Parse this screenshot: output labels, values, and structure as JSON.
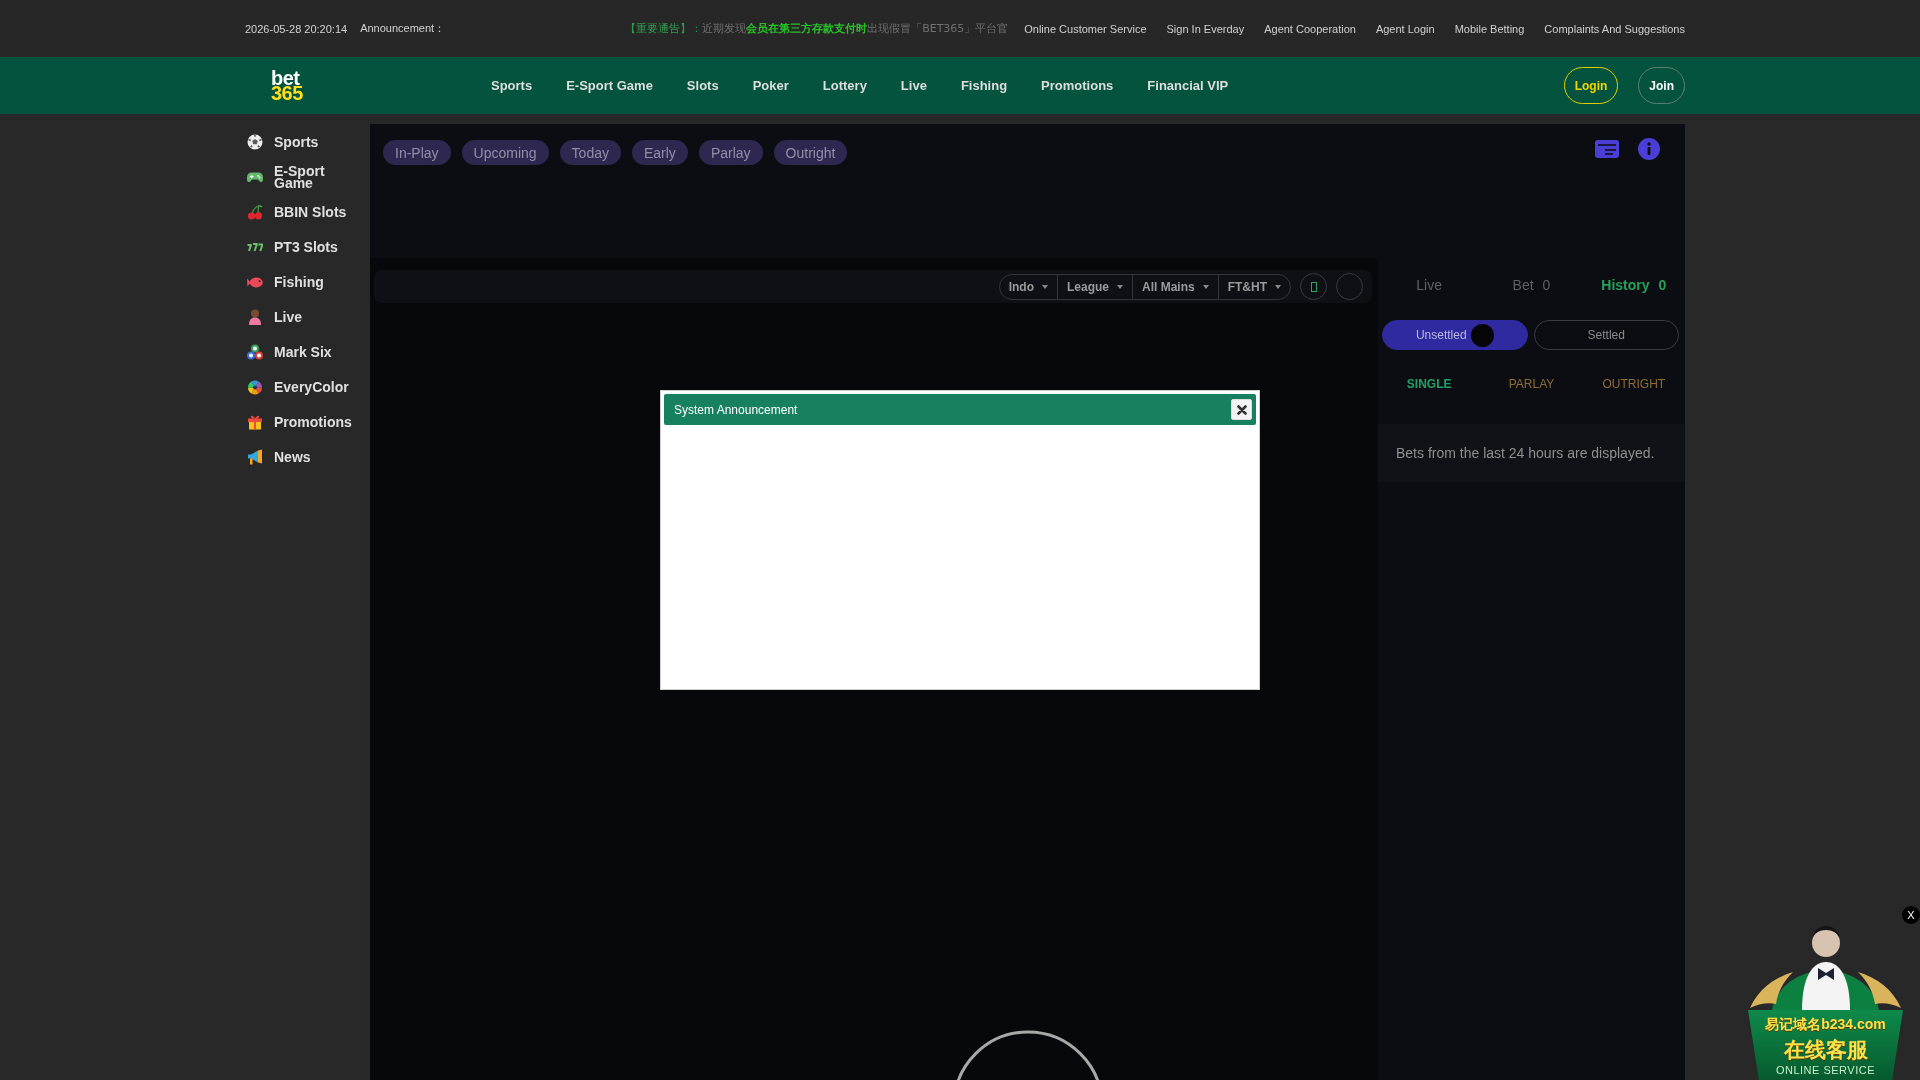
{
  "top_bar": {
    "datetime": "2026-05-28 20:20:14",
    "announcement_label": "Announcement：",
    "announcement": [
      {
        "text": "【重要通告】：",
        "kind": "tag"
      },
      {
        "text": "近期发现",
        "kind": "plain"
      },
      {
        "text": "会员在第三方存款支付时",
        "kind": "highlight"
      },
      {
        "text": "出现假冒「BET365」平台官",
        "kind": "plain"
      }
    ],
    "links": [
      "Online Customer Service",
      "Sign In Everday",
      "Agent Cooperation",
      "Agent Login",
      "Mobile Betting",
      "Complaints And Suggestions"
    ]
  },
  "nav": {
    "logo": {
      "line_1": "bet",
      "line_2": "365"
    },
    "items": [
      "Sports",
      "E-Sport Game",
      "Slots",
      "Poker",
      "Lottery",
      "Live",
      "Fishing",
      "Promotions",
      "Financial VIP"
    ],
    "login": "Login",
    "join": "Join"
  },
  "sidebar": {
    "items": [
      {
        "label": "Sports",
        "kind": "soccer"
      },
      {
        "label": "E-Sport Game",
        "kind": "gamepad"
      },
      {
        "label": "BBIN Slots",
        "kind": "cherry"
      },
      {
        "label": "PT3 Slots",
        "kind": "sevens"
      },
      {
        "label": "Fishing",
        "kind": "fish"
      },
      {
        "label": "Live",
        "kind": "person"
      },
      {
        "label": "Mark Six",
        "kind": "balls"
      },
      {
        "label": "EveryColor",
        "kind": "wheel"
      },
      {
        "label": "Promotions",
        "kind": "gift"
      },
      {
        "label": "News",
        "kind": "megaphone"
      }
    ]
  },
  "market_tabs": [
    {
      "label": "In-Play",
      "selected": false
    },
    {
      "label": "Upcoming",
      "selected": false
    },
    {
      "label": "Today",
      "selected": false
    },
    {
      "label": "Early",
      "selected": false
    },
    {
      "label": "Parlay",
      "selected": false
    },
    {
      "label": "Outright",
      "selected": false
    }
  ],
  "filters": [
    "Indo",
    "League",
    "All Mains",
    "FT&HT"
  ],
  "bet_panel": {
    "tabs": [
      {
        "label": "Live",
        "selected": false
      },
      {
        "label": "Bet",
        "count": "0",
        "selected": false
      },
      {
        "label": "History",
        "count": "0",
        "selected": true
      }
    ],
    "status_toggle": [
      {
        "label": "Unsettled",
        "selected": true
      },
      {
        "label": "Settled",
        "selected": false
      }
    ],
    "bet_types": [
      {
        "label": "SINGLE",
        "selected": true
      },
      {
        "label": "PARLAY",
        "selected": false
      },
      {
        "label": "OUTRIGHT",
        "selected": false
      }
    ],
    "message": "Bets from the last 24 hours are displayed."
  },
  "modal": {
    "title": "System Announcement"
  },
  "service_banner": {
    "domain": "易记域名b234.com",
    "title": "在线客服",
    "subtitle": "ONLINE SERVICE",
    "close": "X"
  }
}
